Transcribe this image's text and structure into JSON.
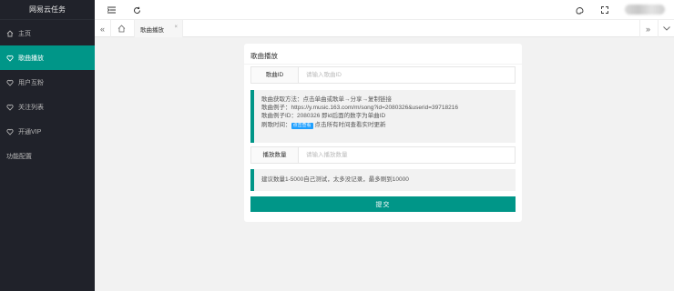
{
  "sidebar": {
    "title": "网易云任务",
    "items": [
      {
        "label": "主页",
        "icon": "home-icon"
      },
      {
        "label": "歌曲播放",
        "icon": "heart-icon",
        "active": true
      },
      {
        "label": "用户互粉",
        "icon": "heart-icon"
      },
      {
        "label": "关注列表",
        "icon": "heart-icon"
      },
      {
        "label": "开通VIP",
        "icon": "heart-icon"
      },
      {
        "label": "功能配置",
        "icon": ""
      }
    ]
  },
  "header": {
    "icons": [
      "menu-fold-icon",
      "refresh-icon",
      "theme-icon",
      "fullscreen-icon"
    ]
  },
  "tabs": {
    "items": [
      {
        "label": "歌曲播放",
        "close": "×"
      }
    ]
  },
  "card": {
    "title": "歌曲播放",
    "song_id": {
      "label": "歌曲ID",
      "placeholder": "请输入歌曲ID",
      "value": ""
    },
    "info": {
      "lines": [
        "歌曲获取方法：点击单曲或歌单→分享→复制链接",
        "歌曲例子：https://y.music.163.com/m/song?id=2080326&userid=39718216",
        "歌曲例子ID：2080326 即id后面的数字为单曲ID"
      ],
      "last_prefix": "刷歌时间：",
      "badge": "点击查看",
      "last_suffix": "点击所有时间查看实时更新"
    },
    "count": {
      "label": "播放数量",
      "placeholder": "请输入播放数量",
      "value": ""
    },
    "advice": "建议数量1-5000自己测试，太多没记录，最多刷到10000",
    "submit_label": "提交"
  },
  "colors": {
    "accent": "#009688",
    "sidebar_bg": "#20222a",
    "badge": "#1e9fff"
  }
}
